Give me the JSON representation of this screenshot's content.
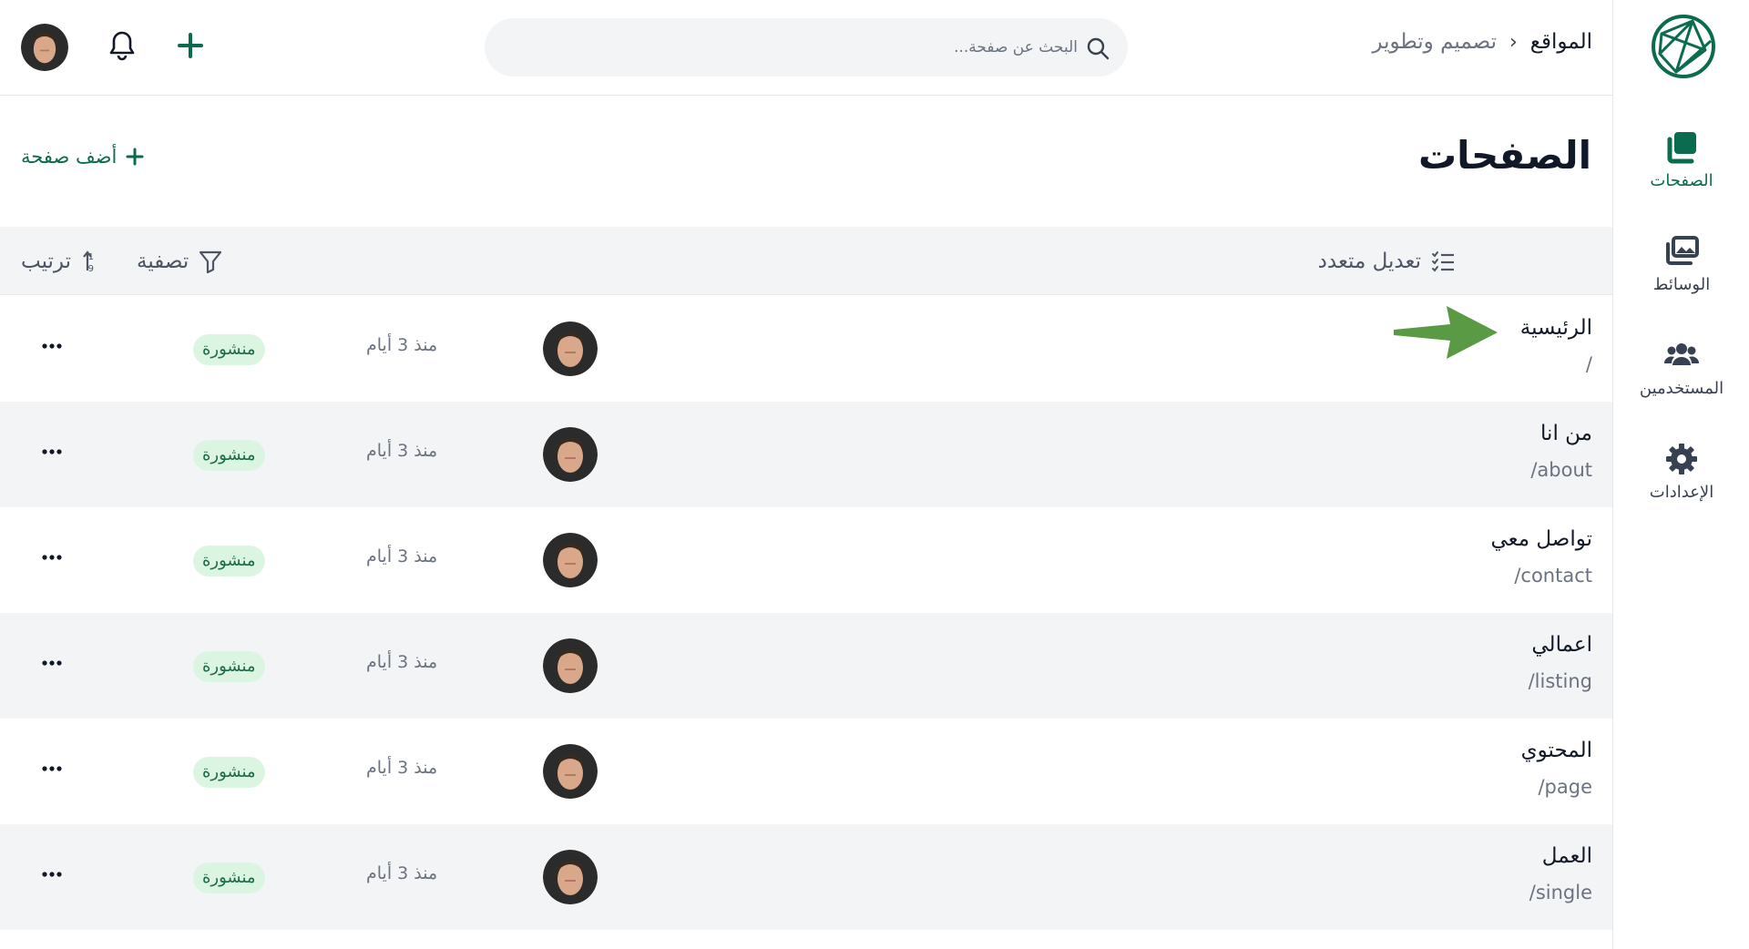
{
  "sidebar": {
    "items": [
      {
        "label": "الصفحات",
        "icon": "pages-icon",
        "active": true
      },
      {
        "label": "الوسائط",
        "icon": "media-icon",
        "active": false
      },
      {
        "label": "المستخدمين",
        "icon": "users-icon",
        "active": false
      },
      {
        "label": "الإعدادات",
        "icon": "gear-icon",
        "active": false
      }
    ]
  },
  "header": {
    "breadcrumb": {
      "root": "المواقع",
      "separator": "‹",
      "current": "تصميم وتطوير"
    },
    "search": {
      "placeholder": "البحث عن صفحة..."
    }
  },
  "page": {
    "title": "الصفحات",
    "add_label": "أضف صفحة"
  },
  "toolbar": {
    "bulk_edit": "تعديل متعدد",
    "filter": "تصفية",
    "sort": "ترتيب"
  },
  "rows": [
    {
      "title": "الرئيسية",
      "slug": "/",
      "date": "منذ 3 أيام",
      "status": "منشورة"
    },
    {
      "title": "من انا",
      "slug": "/about",
      "date": "منذ 3 أيام",
      "status": "منشورة"
    },
    {
      "title": "تواصل معي",
      "slug": "/contact",
      "date": "منذ 3 أيام",
      "status": "منشورة"
    },
    {
      "title": "اعمالي",
      "slug": "/listing",
      "date": "منذ 3 أيام",
      "status": "منشورة"
    },
    {
      "title": "المحتوي",
      "slug": "/page",
      "date": "منذ 3 أيام",
      "status": "منشورة"
    },
    {
      "title": "العمل",
      "slug": "/single",
      "date": "منذ 3 أيام",
      "status": "منشورة"
    }
  ],
  "colors": {
    "accent": "#0b6b4f",
    "badge_bg": "#dcf5e3",
    "arrow": "#5a9a45",
    "row_alt": "#f3f4f6"
  }
}
